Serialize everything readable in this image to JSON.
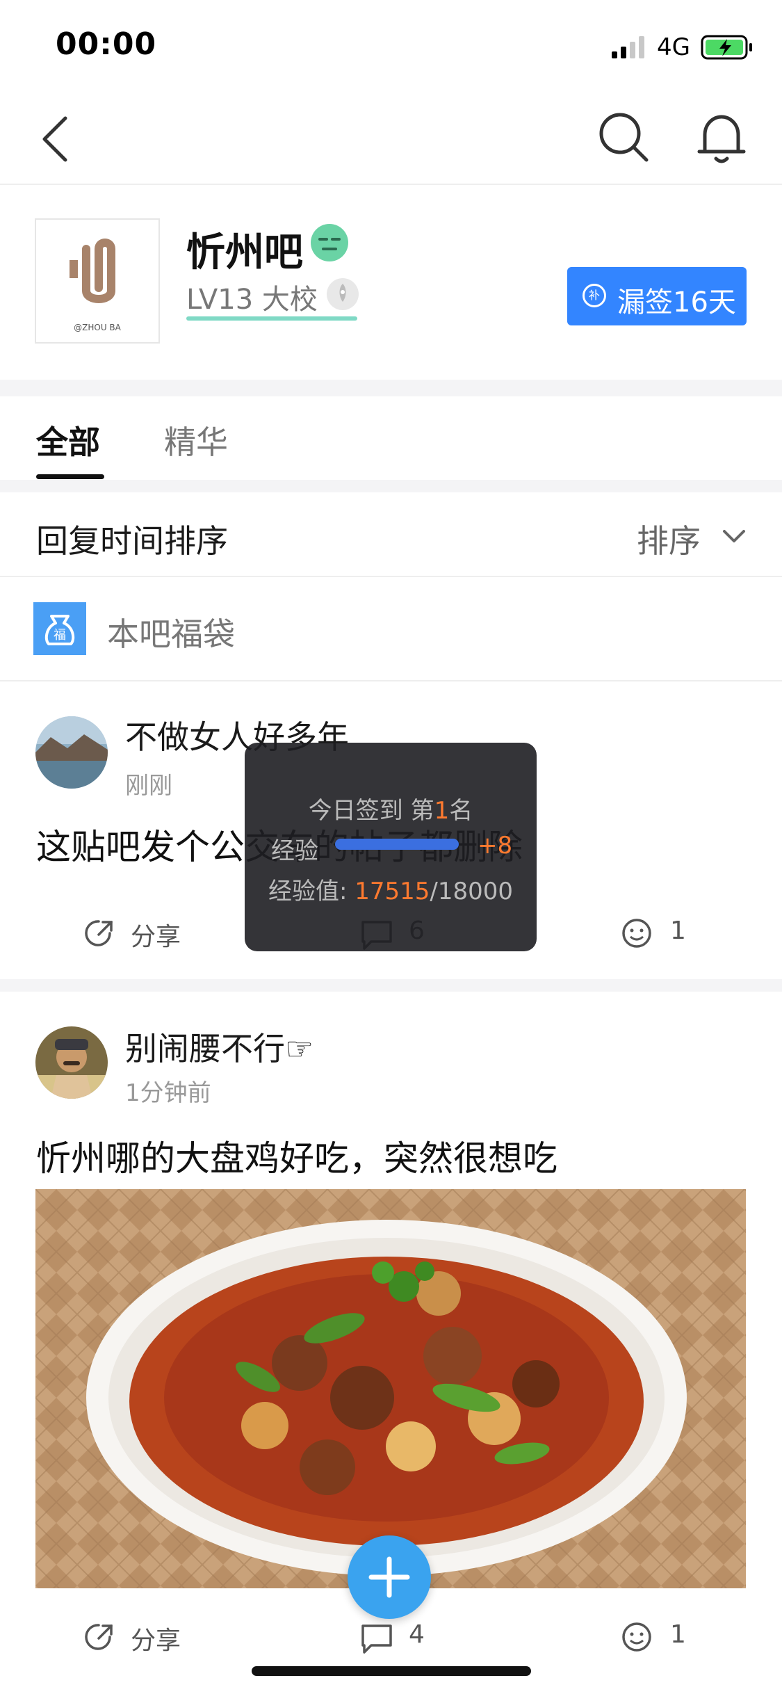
{
  "status_bar": {
    "time": "00:00",
    "network": "4G"
  },
  "forum": {
    "name": "忻州吧",
    "level": "LV13 大校",
    "logo_caption": "@ZHOU BA",
    "sign_button": "漏签16天",
    "sign_icon_char": "补"
  },
  "tabs": [
    {
      "label": "全部"
    },
    {
      "label": "精华"
    }
  ],
  "sort": {
    "title": "回复时间排序",
    "button": "排序"
  },
  "lucky_bag": {
    "label": "本吧福袋",
    "icon_char": "福"
  },
  "posts": [
    {
      "username": "不做女人好多年",
      "time": "刚刚",
      "title": "这贴吧发个公交车的帖子都删除",
      "share_label": "分享",
      "comments": "6",
      "likes": "1"
    },
    {
      "username": "别闹腰不行☞",
      "time": "1分钟前",
      "title": "忻州哪的大盘鸡好吃，突然很想吃",
      "share_label": "分享",
      "comments": "4",
      "likes": "1"
    }
  ],
  "toast": {
    "line1_prefix": "今日签到 第",
    "rank": "1",
    "line1_suffix": "名",
    "exp_label": "经验",
    "exp_gain": "+8",
    "exp_value_label": "经验值: ",
    "exp_current": "17515",
    "exp_total": "/18000"
  },
  "colors": {
    "accent": "#3385ff",
    "fab": "#3aa3ef",
    "highlight": "#ff7a2f"
  }
}
